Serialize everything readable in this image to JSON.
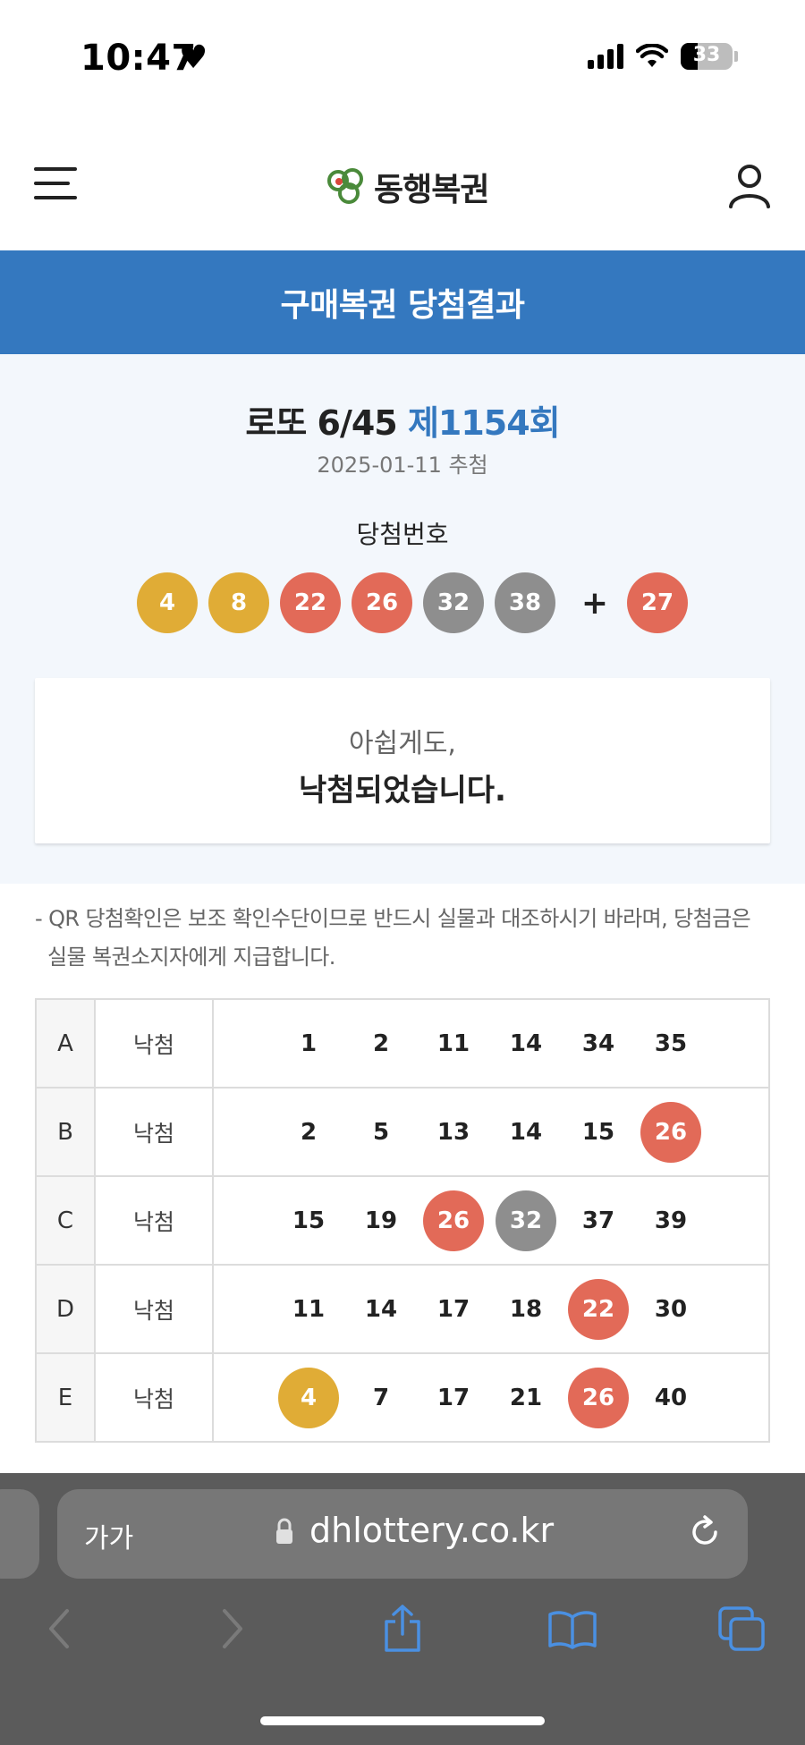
{
  "status_bar": {
    "time": "10:47",
    "battery": "33"
  },
  "header": {
    "logo_text": "동행복권"
  },
  "page_title": "구매복권 당첨결과",
  "draw": {
    "game": "로또 6/45",
    "round": "제1154회",
    "date": "2025-01-11 추첨",
    "winning_label": "당첨번호",
    "numbers": [
      "4",
      "8",
      "22",
      "26",
      "32",
      "38"
    ],
    "plus": "+",
    "bonus": "27"
  },
  "result": {
    "sub": "아쉽게도,",
    "main": "낙첨되었습니다."
  },
  "notice": "- QR 당첨확인은 보조 확인수단이므로 반드시 실물과 대조하시기 바라며, 당첨금은 실물 복권소지자에게 지급합니다.",
  "tickets": [
    {
      "id": "A",
      "result": "낙첨",
      "numbers": [
        "1",
        "2",
        "11",
        "14",
        "34",
        "35"
      ]
    },
    {
      "id": "B",
      "result": "낙첨",
      "numbers": [
        "2",
        "5",
        "13",
        "14",
        "15",
        "26"
      ]
    },
    {
      "id": "C",
      "result": "낙첨",
      "numbers": [
        "15",
        "19",
        "26",
        "32",
        "37",
        "39"
      ]
    },
    {
      "id": "D",
      "result": "낙첨",
      "numbers": [
        "11",
        "14",
        "17",
        "18",
        "22",
        "30"
      ]
    },
    {
      "id": "E",
      "result": "낙첨",
      "numbers": [
        "4",
        "7",
        "17",
        "21",
        "26",
        "40"
      ]
    }
  ],
  "ball_colors": {
    "yellow": "#e0ac36",
    "red": "#e26a58",
    "gray": "#8e8e8e",
    "blue": "#3478bf"
  },
  "browser": {
    "text_size_label": "가가",
    "url": "dhlottery.co.kr"
  },
  "icons": [
    "menu-icon",
    "logo-icon",
    "user-icon",
    "lock-icon",
    "reload-icon",
    "back-icon",
    "forward-icon",
    "share-icon",
    "bookmarks-icon",
    "tabs-icon"
  ]
}
